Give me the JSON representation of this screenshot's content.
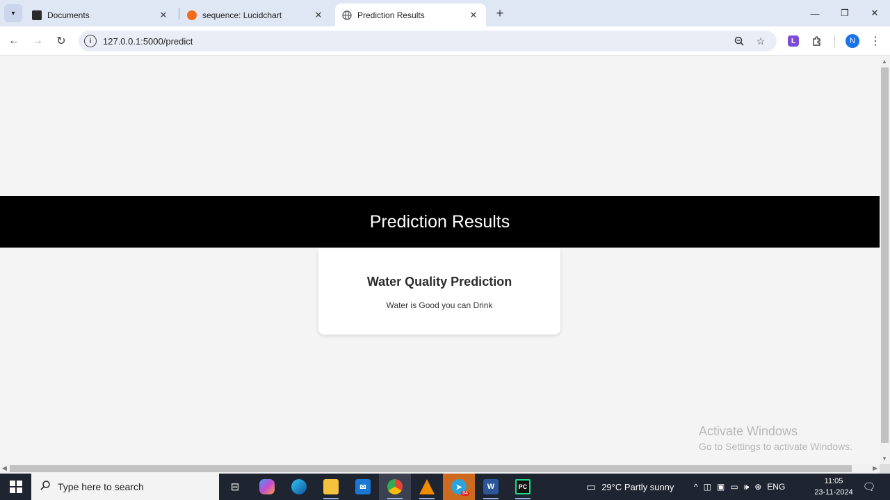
{
  "browser": {
    "tabs": [
      {
        "title": "Documents",
        "favicon": "lucid-docs-icon"
      },
      {
        "title": "sequence: Lucidchart",
        "favicon": "lucidchart-icon"
      },
      {
        "title": "Prediction Results",
        "favicon": "globe-icon",
        "active": true
      }
    ],
    "url": "127.0.0.1:5000/predict",
    "extension_letter": "L",
    "profile_initial": "N",
    "close_glyph": "✕"
  },
  "page": {
    "banner_title": "Prediction Results",
    "card_title": "Water Quality Prediction",
    "card_result": "Water is Good you can Drink",
    "watermark_line1": "Activate Windows",
    "watermark_line2": "Go to Settings to activate Windows."
  },
  "taskbar": {
    "search_placeholder": "Type here to search",
    "apps": [
      "task-view",
      "copilot",
      "edge",
      "file-explorer",
      "mail",
      "chrome",
      "vlc",
      "telegram",
      "word",
      "pycharm"
    ],
    "telegram_badge": "84",
    "weather": "29°C  Partly sunny",
    "language": "ENG",
    "time": "11:05",
    "date": "23-11-2024"
  },
  "colors": {
    "banner_bg": "#000000",
    "page_bg": "#f4f4f4",
    "card_bg": "#ffffff",
    "taskbar_bg": "#1e2430"
  }
}
